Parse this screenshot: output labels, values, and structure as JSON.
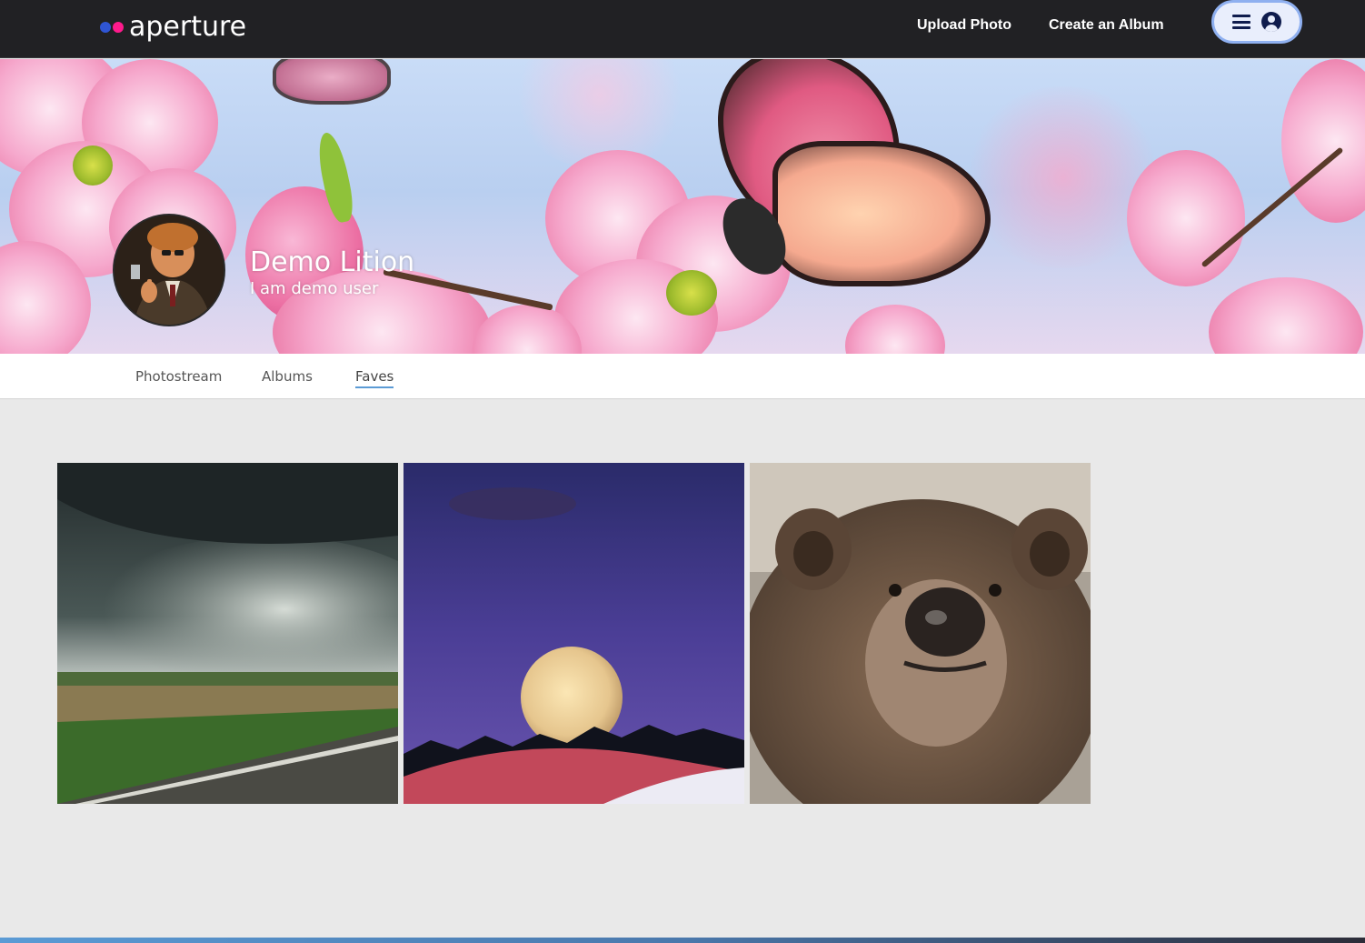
{
  "nav": {
    "logo_text": "aperture",
    "upload_label": "Upload Photo",
    "album_label": "Create an Album"
  },
  "profile": {
    "name": "Demo Lition",
    "bio": "I am demo user"
  },
  "tabs": [
    {
      "label": "Photostream",
      "active": false
    },
    {
      "label": "Albums",
      "active": false
    },
    {
      "label": "Faves",
      "active": true
    }
  ],
  "gallery": [
    {
      "subject": "storm-field-road"
    },
    {
      "subject": "full-moon-forest"
    },
    {
      "subject": "brown-bear"
    }
  ],
  "colors": {
    "nav_bg": "#212124",
    "brand_blue": "#2f55d4",
    "brand_pink": "#ff1a8c",
    "accent": "#5b9bd5",
    "page_bg": "#e9e9e9"
  }
}
